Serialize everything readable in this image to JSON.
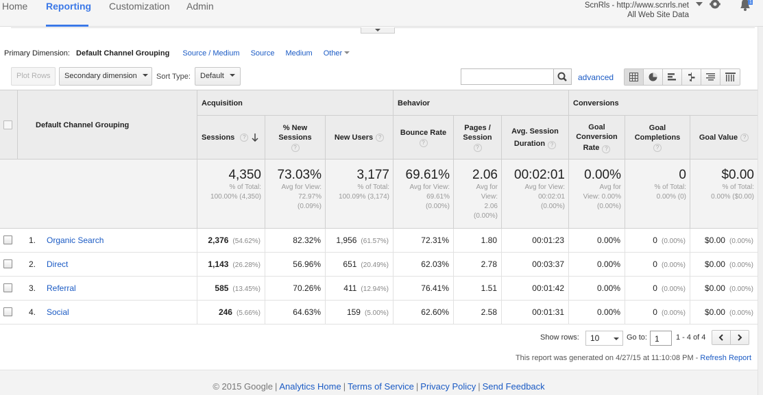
{
  "nav": {
    "tabs": [
      "Home",
      "Reporting",
      "Customization",
      "Admin"
    ],
    "active": 1,
    "account_name": "ScnRls - http://www.scnrls.net",
    "account_view": "All Web Site Data",
    "notification_count": "1"
  },
  "primary_dimension": {
    "label": "Primary Dimension:",
    "current": "Default Channel Grouping",
    "options": [
      "Source / Medium",
      "Source",
      "Medium"
    ],
    "other": "Other"
  },
  "toolbar": {
    "plot_rows": "Plot Rows",
    "secondary_dimension": "Secondary dimension",
    "sort_type_label": "Sort Type:",
    "sort_type_value": "Default",
    "search_value": "",
    "advanced": "advanced"
  },
  "table": {
    "dimension_header": "Default Channel Grouping",
    "groups": [
      "Acquisition",
      "Behavior",
      "Conversions"
    ],
    "columns": {
      "sessions": "Sessions",
      "new_sessions_1": "% New",
      "new_sessions_2": "Sessions",
      "new_users": "New Users",
      "bounce_rate": "Bounce Rate",
      "pages_1": "Pages /",
      "pages_2": "Session",
      "avg_1": "Avg. Session",
      "avg_2": "Duration",
      "gcr_1": "Goal",
      "gcr_2": "Conversion",
      "gcr_3": "Rate",
      "gc_1": "Goal",
      "gc_2": "Completions",
      "goal_value": "Goal Value",
      "help": "?"
    },
    "totals": {
      "sessions": {
        "value": "4,350",
        "l1": "% of Total:",
        "l2": "100.00% (4,350)"
      },
      "new_sessions": {
        "value": "73.03%",
        "l1": "Avg for View:",
        "l2": "72.97%",
        "l3": "(0.09%)"
      },
      "new_users": {
        "value": "3,177",
        "l1": "% of Total:",
        "l2": "100.09% (3,174)"
      },
      "bounce_rate": {
        "value": "69.61%",
        "l1": "Avg for View:",
        "l2": "69.61%",
        "l3": "(0.00%)"
      },
      "pages": {
        "value": "2.06",
        "l1": "Avg for",
        "l2": "View:",
        "l3": "2.06",
        "l4": "(0.00%)"
      },
      "duration": {
        "value": "00:02:01",
        "l1": "Avg for View:",
        "l2": "00:02:01",
        "l3": "(0.00%)"
      },
      "gcr": {
        "value": "0.00%",
        "l1": "Avg for",
        "l2": "View: 0.00%",
        "l3": "(0.00%)"
      },
      "gc": {
        "value": "0",
        "l1": "% of Total:",
        "l2": "0.00% (0)"
      },
      "goal_value": {
        "value": "$0.00",
        "l1": "% of Total:",
        "l2": "0.00% ($0.00)"
      }
    },
    "rows": [
      {
        "n": "1.",
        "channel": "Organic Search",
        "sessions": "2,376",
        "sessions_pct": "(54.62%)",
        "new_sessions": "82.32%",
        "new_users": "1,956",
        "new_users_pct": "(61.57%)",
        "bounce": "72.31%",
        "pages": "1.80",
        "duration": "00:01:23",
        "gcr": "0.00%",
        "gc": "0",
        "gc_pct": "(0.00%)",
        "gv": "$0.00",
        "gv_pct": "(0.00%)"
      },
      {
        "n": "2.",
        "channel": "Direct",
        "sessions": "1,143",
        "sessions_pct": "(26.28%)",
        "new_sessions": "56.96%",
        "new_users": "651",
        "new_users_pct": "(20.49%)",
        "bounce": "62.03%",
        "pages": "2.78",
        "duration": "00:03:37",
        "gcr": "0.00%",
        "gc": "0",
        "gc_pct": "(0.00%)",
        "gv": "$0.00",
        "gv_pct": "(0.00%)"
      },
      {
        "n": "3.",
        "channel": "Referral",
        "sessions": "585",
        "sessions_pct": "(13.45%)",
        "new_sessions": "70.26%",
        "new_users": "411",
        "new_users_pct": "(12.94%)",
        "bounce": "76.41%",
        "pages": "1.51",
        "duration": "00:01:42",
        "gcr": "0.00%",
        "gc": "0",
        "gc_pct": "(0.00%)",
        "gv": "$0.00",
        "gv_pct": "(0.00%)"
      },
      {
        "n": "4.",
        "channel": "Social",
        "sessions": "246",
        "sessions_pct": "(5.66%)",
        "new_sessions": "64.63%",
        "new_users": "159",
        "new_users_pct": "(5.00%)",
        "bounce": "62.60%",
        "pages": "2.58",
        "duration": "00:01:31",
        "gcr": "0.00%",
        "gc": "0",
        "gc_pct": "(0.00%)",
        "gv": "$0.00",
        "gv_pct": "(0.00%)"
      }
    ]
  },
  "pagination": {
    "show_rows_label": "Show rows:",
    "show_rows_value": "10",
    "goto_label": "Go to:",
    "goto_value": "1",
    "range": "1 - 4 of 4"
  },
  "report_note": {
    "text": "This report was generated on 4/27/15 at 11:10:08 PM -",
    "refresh": "Refresh Report"
  },
  "footer": {
    "copyright": "© 2015 Google",
    "links": [
      "Analytics Home",
      "Terms of Service",
      "Privacy Policy",
      "Send Feedback"
    ]
  },
  "colors": {
    "accent": "#3b78e7",
    "link": "#1a5ac4",
    "header_bg": "#ececec"
  }
}
